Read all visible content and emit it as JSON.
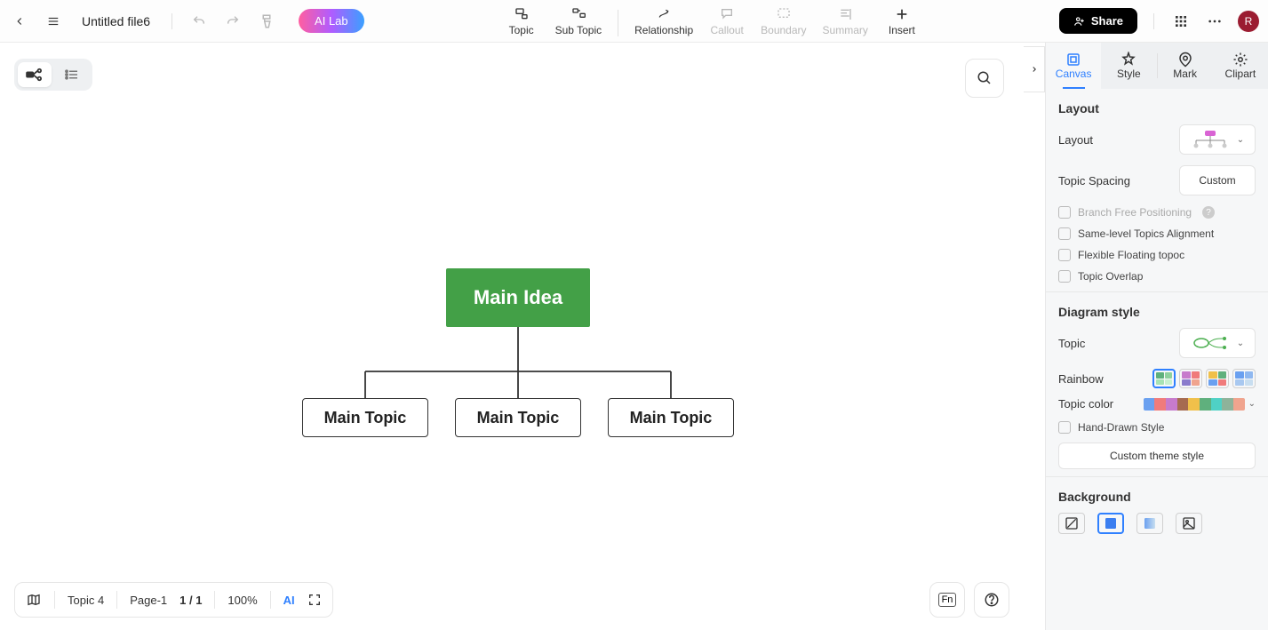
{
  "header": {
    "file_title": "Untitled file6",
    "ai_lab": "AI Lab",
    "share": "Share",
    "avatar_initial": "R"
  },
  "toolbar": {
    "topic": "Topic",
    "subtopic": "Sub Topic",
    "relationship": "Relationship",
    "callout": "Callout",
    "boundary": "Boundary",
    "summary": "Summary",
    "insert": "Insert"
  },
  "mindmap": {
    "root": "Main Idea",
    "children": [
      "Main Topic",
      "Main Topic",
      "Main Topic"
    ]
  },
  "side_tabs": {
    "canvas": "Canvas",
    "style": "Style",
    "mark": "Mark",
    "clipart": "Clipart"
  },
  "panel": {
    "layout_title": "Layout",
    "layout_label": "Layout",
    "topic_spacing_label": "Topic Spacing",
    "topic_spacing_value": "Custom",
    "branch_free": "Branch Free Positioning",
    "same_level": "Same-level Topics Alignment",
    "flex_float": "Flexible Floating topoc",
    "topic_overlap": "Topic Overlap",
    "diagram_style_title": "Diagram style",
    "topic_label": "Topic",
    "rainbow_label": "Rainbow",
    "topic_color_label": "Topic color",
    "hand_drawn": "Hand-Drawn Style",
    "custom_theme": "Custom theme style",
    "background_title": "Background",
    "topic_colors": [
      "#6aa0f0",
      "#f07b7b",
      "#c77bcc",
      "#a66b50",
      "#f0c04a",
      "#5fb07d",
      "#4fd1c5",
      "#8eb39a",
      "#f0a48e"
    ]
  },
  "rainbow_swatches": [
    [
      "#5fb07d",
      "#8fd19e",
      "#a7e3b4",
      "#c8f0d0"
    ],
    [
      "#c77bcc",
      "#f07b7b",
      "#8a7bcc",
      "#f0a48e"
    ],
    [
      "#f0c04a",
      "#5fb07d",
      "#6aa0f0",
      "#f07b7b"
    ],
    [
      "#6aa0f0",
      "#8fb8f0",
      "#a8c8f0",
      "#c8def0"
    ]
  ],
  "footer": {
    "topic_count": "Topic 4",
    "page_label": "Page-1",
    "page_num": "1 / 1",
    "zoom": "100%",
    "ai": "AI",
    "fn": "Fn"
  }
}
